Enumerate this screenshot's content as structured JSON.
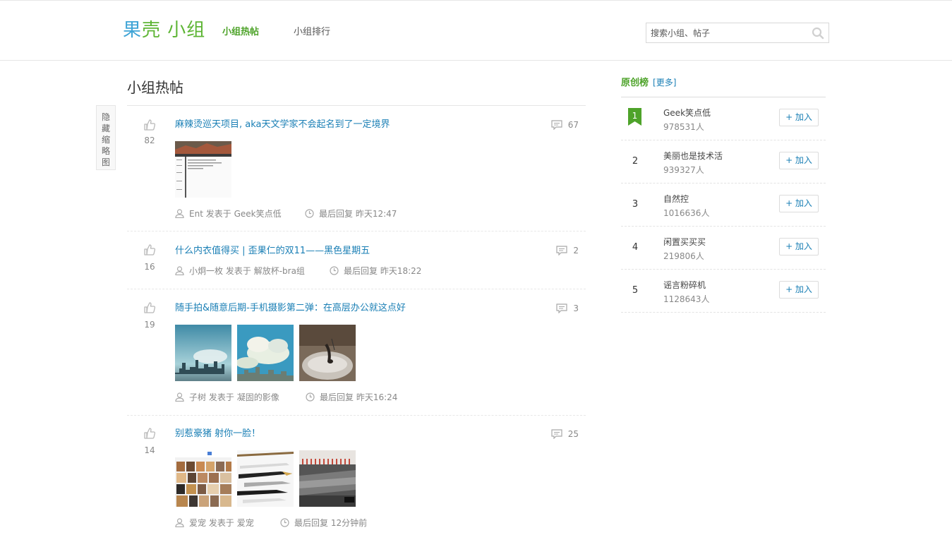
{
  "header": {
    "logo_part1": "果",
    "logo_part2": "壳",
    "logo_part3": " 小组",
    "nav_hot": "小组热帖",
    "nav_rank": "小组排行",
    "search_placeholder": "搜索小组、帖子"
  },
  "side_toggle": "隐藏缩略图",
  "main": {
    "title": "小组热帖",
    "posts": [
      {
        "votes": "82",
        "title": "麻辣烫巡天项目, aka天文学家不会起名到了一定境界",
        "comments": "67",
        "author": "Ent",
        "posted_in_label": "发表于",
        "group": "Geek笑点低",
        "last_reply_label": "最后回复",
        "last_reply_time": "昨天12:47"
      },
      {
        "votes": "16",
        "title": "什么内衣值得买 | 歪果仁的双11——黑色星期五",
        "comments": "2",
        "author": "小炯一枚",
        "posted_in_label": "发表于",
        "group": "解放杯-bra组",
        "last_reply_label": "最后回复",
        "last_reply_time": "昨天18:22"
      },
      {
        "votes": "19",
        "title": "随手拍&随意后期-手机摄影第二弹：在高层办公就这点好",
        "comments": "3",
        "author": "子树",
        "posted_in_label": "发表于",
        "group": "凝固的影像",
        "last_reply_label": "最后回复",
        "last_reply_time": "昨天16:24"
      },
      {
        "votes": "14",
        "title": "别惹豪猪 射你一脸！",
        "comments": "25",
        "author": "爱宠",
        "posted_in_label": "发表于",
        "group": "爱宠",
        "last_reply_label": "最后回复",
        "last_reply_time": "12分钟前"
      }
    ]
  },
  "sidebar": {
    "title": "原创榜",
    "more": "[更多]",
    "join_label": "+ 加入",
    "items": [
      {
        "rank": "1",
        "name": "Geek笑点低",
        "members": "978531人"
      },
      {
        "rank": "2",
        "name": "美丽也是技术活",
        "members": "939327人"
      },
      {
        "rank": "3",
        "name": "自然控",
        "members": "1016636人"
      },
      {
        "rank": "4",
        "name": "闲置买买买",
        "members": "219806人"
      },
      {
        "rank": "5",
        "name": "谣言粉碎机",
        "members": "1128643人"
      }
    ]
  },
  "colors": {
    "brand_green": "#4ea32a",
    "link_blue": "#1a7fb5",
    "logo_blue": "#3fa4d6"
  },
  "icons": {
    "search": "search-icon",
    "vote": "thumbs-up-icon",
    "comment": "comment-icon",
    "user": "user-icon",
    "clock": "clock-icon",
    "rank_badge": "ribbon-badge-icon"
  }
}
